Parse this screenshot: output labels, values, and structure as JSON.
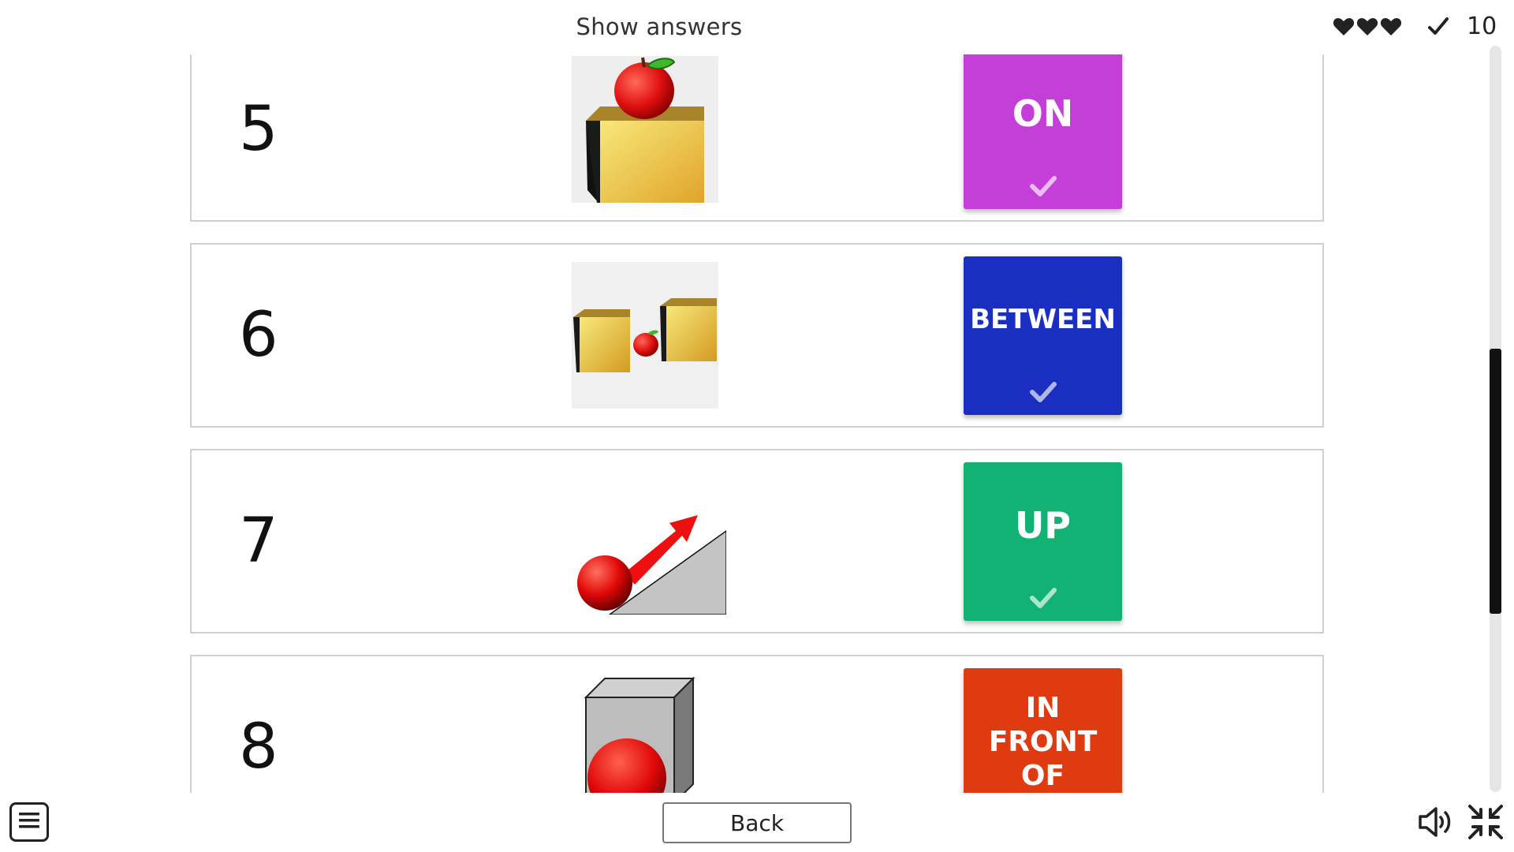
{
  "header": {
    "title": "Show answers",
    "lives_icons": [
      "heart-icon",
      "heart-icon",
      "heart-icon"
    ],
    "score_icon": "check-icon",
    "score": "10"
  },
  "rows": [
    {
      "number": "5",
      "image": "apple-on-box",
      "answer": "ON",
      "color": "#c33fd8"
    },
    {
      "number": "6",
      "image": "apple-between-boxes",
      "answer": "BETWEEN",
      "color": "#1a2fc2"
    },
    {
      "number": "7",
      "image": "ball-up-slope",
      "answer": "UP",
      "color": "#12b274"
    },
    {
      "number": "8",
      "image": "ball-in-front-of-box",
      "answer": "IN FRONT OF",
      "color": "#e03a10"
    }
  ],
  "footer": {
    "menu_icon": "menu-icon",
    "back_label": "Back",
    "sound_icon": "speaker-icon",
    "fullscreen_icon": "exit-fullscreen-icon"
  }
}
